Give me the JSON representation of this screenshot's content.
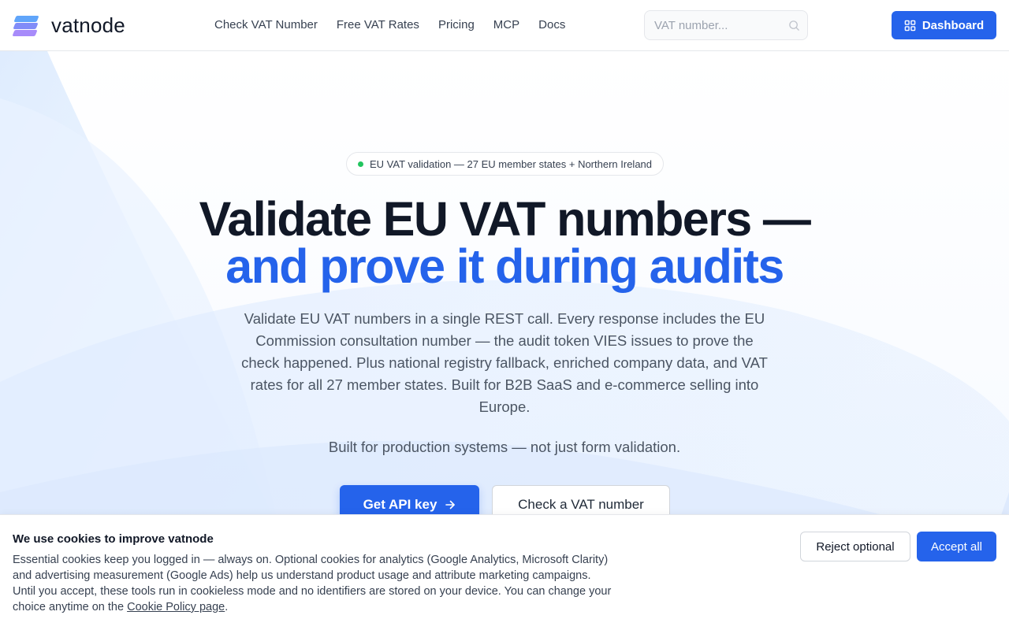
{
  "brand": {
    "name": "vatnode"
  },
  "nav": {
    "items": [
      {
        "label": "Check VAT Number"
      },
      {
        "label": "Free VAT Rates"
      },
      {
        "label": "Pricing"
      },
      {
        "label": "MCP"
      },
      {
        "label": "Docs"
      }
    ]
  },
  "search": {
    "placeholder": "VAT number...",
    "value": ""
  },
  "header": {
    "dashboard_label": "Dashboard"
  },
  "hero": {
    "badge": "EU VAT validation — 27 EU member states + Northern Ireland",
    "title_line1": "Validate EU VAT numbers —",
    "title_line2": "and prove it during audits",
    "lead": "Validate EU VAT numbers in a single REST call. Every response includes the EU Commission consultation number — the audit token VIES issues to prove the check happened. Plus national registry fallback, enriched company data, and VAT rates for all 27 member states. Built for B2B SaaS and e-commerce selling into Europe.",
    "subline": "Built for production systems — not just form validation.",
    "primary_cta": "Get API key",
    "secondary_cta": "Check a VAT number"
  },
  "cookie": {
    "title": "We use cookies to improve vatnode",
    "text": "Essential cookies keep you logged in — always on. Optional cookies for analytics (Google Analytics, Microsoft Clarity) and advertising measurement (Google Ads) help us understand product usage and attribute marketing campaigns. Until you accept, these tools run in cookieless mode and no identifiers are stored on your device. You can change your choice anytime on the",
    "link": "Cookie Policy page",
    "after_link": ".",
    "reject": "Reject optional",
    "accept": "Accept all"
  },
  "colors": {
    "accent": "#2563eb",
    "heading": "#111827",
    "body_text": "#4b5563",
    "status_dot": "#22c55e"
  },
  "icons": {
    "search": "search-icon",
    "dashboard": "grid-icon",
    "arrow": "arrow-right-icon",
    "status": "status-dot-icon"
  }
}
